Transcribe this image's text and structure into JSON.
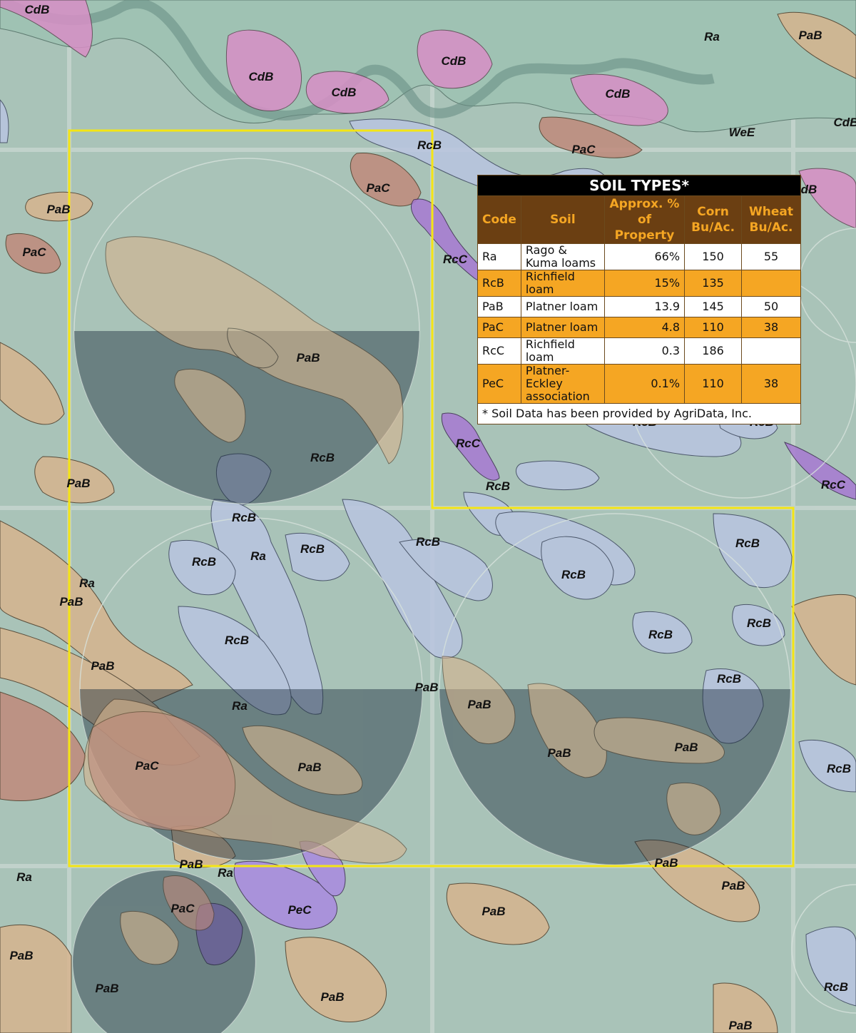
{
  "labels": [
    "CdB",
    "CdB",
    "CdB",
    "CdB",
    "CdB",
    "CdB",
    "Ra",
    "PaB",
    "WeE",
    "RcB",
    "PaC",
    "PaC",
    "PaB",
    "PaC",
    "RcC",
    "dB",
    "PaB",
    "RcB",
    "RcC",
    "RcB",
    "RcB",
    "RcB",
    "RcC",
    "PaB",
    "RcB",
    "Ra",
    "RcB",
    "RcB",
    "RcB",
    "RcB",
    "Ra",
    "PaB",
    "RcB",
    "RcB",
    "RcB",
    "PaB",
    "RcB",
    "RcB",
    "Ra",
    "PaB",
    "PaB",
    "PaC",
    "PaB",
    "PaB",
    "PaB",
    "RcB",
    "PaB",
    "Ra",
    "PaB",
    "Ra",
    "PaC",
    "PeC",
    "PaB",
    "PaB",
    "PaB",
    "PaB",
    "PaB",
    "RcB",
    "PaB"
  ],
  "table": {
    "title": "SOIL TYPES*",
    "headers": {
      "code": "Code",
      "soil": "Soil",
      "pct": "Approx. % of Property",
      "corn": "Corn Bu/Ac.",
      "wheat": "Wheat Bu/Ac."
    },
    "rows": [
      {
        "code": "Ra",
        "soil": "Rago & Kuma loams",
        "pct": "66%",
        "corn": "150",
        "wheat": "55"
      },
      {
        "code": "RcB",
        "soil": "Richfield loam",
        "pct": "15%",
        "corn": "135",
        "wheat": ""
      },
      {
        "code": "PaB",
        "soil": "Platner loam",
        "pct": "13.9",
        "corn": "145",
        "wheat": "50"
      },
      {
        "code": "PaC",
        "soil": "Platner loam",
        "pct": "4.8",
        "corn": "110",
        "wheat": "38"
      },
      {
        "code": "RcC",
        "soil": "Richfield loam",
        "pct": "0.3",
        "corn": "186",
        "wheat": ""
      },
      {
        "code": "PeC",
        "soil": "Platner-Eckley association",
        "pct": "0.1%",
        "corn": "110",
        "wheat": "38"
      }
    ],
    "footnote": "* Soil Data has been provided by AgriData, Inc."
  },
  "colors": {
    "ra": "#a9c3b8",
    "rcb": "#b9c5e0",
    "pab": "#d6b48e",
    "pac": "#c08a7c",
    "cdb": "#d88fc6",
    "rcc": "#a77ad2",
    "pec": "#a98ae0",
    "boundary": "#f4e515",
    "table_header_bg": "#6b3f12",
    "table_header_text": "#f5a623",
    "table_alt_row": "#f5a623"
  }
}
